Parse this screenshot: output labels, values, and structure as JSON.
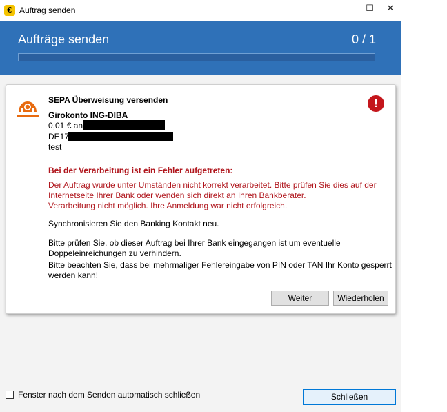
{
  "window": {
    "title": "Auftrag senden",
    "app_icon_glyph": "€",
    "minimize_glyph": "☐",
    "close_glyph": "✕"
  },
  "header": {
    "title": "Aufträge senden",
    "count": "0 / 1",
    "progress_fraction": 0.0
  },
  "order": {
    "type": "SEPA Überweisung versenden",
    "account": "Girokonto ING-DIBA",
    "amount_prefix": "0,01 € an",
    "iban_prefix": "DE17",
    "purpose": "test"
  },
  "error": {
    "heading": "Bei der Verarbeitung ist ein Fehler aufgetreten:",
    "line1": "Der Auftrag wurde unter Umständen nicht korrekt verarbeitet. Bitte prüfen Sie dies auf der",
    "line2": "Internetseite Ihrer Bank oder wenden sich direkt an Ihren Bankberater.",
    "line3": "Verarbeitung nicht möglich. Ihre Anmeldung war nicht erfolgreich.",
    "icon_glyph": "!"
  },
  "info": {
    "sync": "Synchronisieren Sie den Banking Kontakt neu.",
    "check1": "Bitte prüfen Sie, ob dieser Auftrag bei Ihrer Bank eingegangen ist um eventuelle",
    "check2": "Doppeleinreichungen zu verhindern.",
    "warn1": "Bitte beachten Sie, dass bei mehrmaliger Fehlereingabe von PIN oder TAN Ihr Konto gesperrt",
    "warn2": "werden kann!"
  },
  "buttons": {
    "next": "Weiter",
    "retry": "Wiederholen",
    "close": "Schließen"
  },
  "footer": {
    "auto_close_label": "Fenster nach dem Senden automatisch schließen",
    "auto_close_checked": false
  },
  "colors": {
    "header_bg": "#2f71b8",
    "error_red": "#b0161d",
    "bank_orange": "#e86b10"
  }
}
